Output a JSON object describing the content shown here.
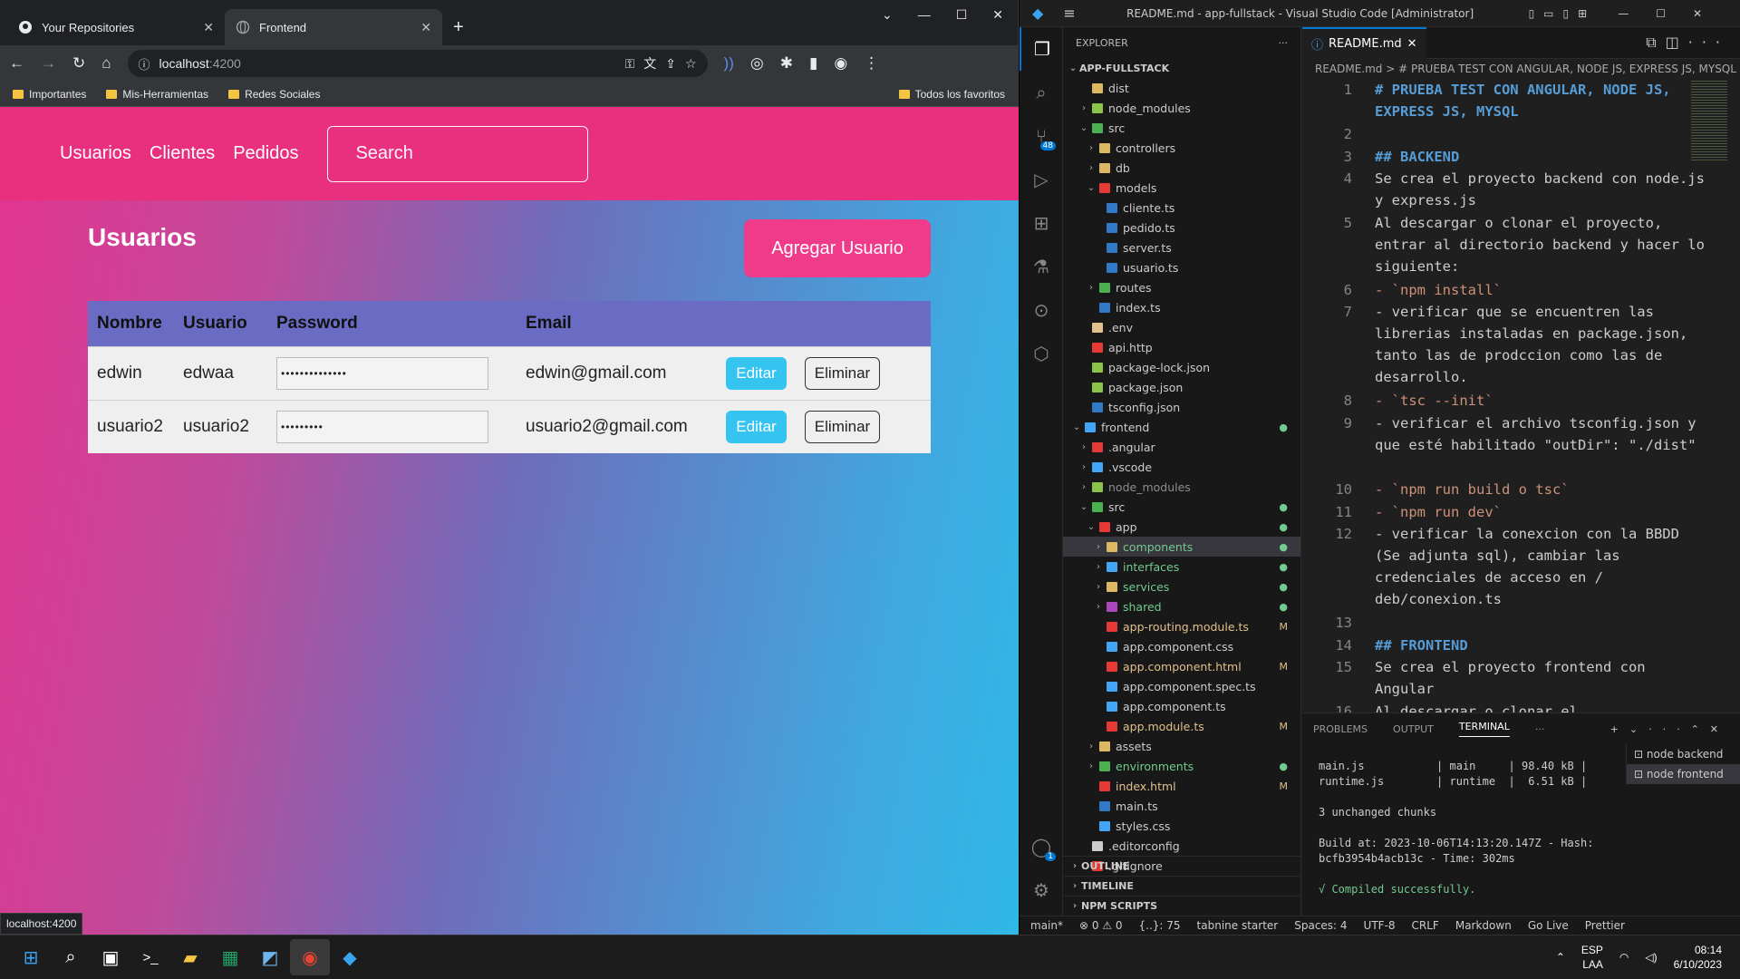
{
  "browser": {
    "tabs": [
      {
        "title": "Your Repositories",
        "icon": "github-icon"
      },
      {
        "title": "Frontend",
        "icon": "globe-icon"
      }
    ],
    "url_host": "localhost",
    "url_port": ":4200",
    "bookmarks": [
      "Importantes",
      "Mis-Herramientas",
      "Redes Sociales"
    ],
    "bookmarks_right": "Todos los favoritos",
    "status_url": "localhost:4200"
  },
  "app": {
    "nav": [
      "Usuarios",
      "Clientes",
      "Pedidos"
    ],
    "search_placeholder": "Search",
    "heading": "Usuarios",
    "add_button": "Agregar Usuario",
    "columns": [
      "Nombre",
      "Usuario",
      "Password",
      "Email"
    ],
    "rows": [
      {
        "nombre": "edwin",
        "usuario": "edwaa",
        "password": "••••••••••••••",
        "email": "edwin@gmail.com",
        "edit": "Editar",
        "delete": "Eliminar"
      },
      {
        "nombre": "usuario2",
        "usuario": "usuario2",
        "password": "•••••••••",
        "email": "usuario2@gmail.com",
        "edit": "Editar",
        "delete": "Eliminar"
      }
    ]
  },
  "vscode": {
    "title": "README.md - app-fullstack - Visual Studio Code [Administrator]",
    "explorer_label": "EXPLORER",
    "root": "APP-FULLSTACK",
    "scm_badge": "48",
    "account_badge": "1",
    "tree": [
      {
        "label": "dist",
        "depth": 2,
        "chev": "",
        "color": "#dcb862"
      },
      {
        "label": "node_modules",
        "depth": 2,
        "chev": "›",
        "color": "#8bc34a"
      },
      {
        "label": "src",
        "depth": 2,
        "chev": "⌄",
        "color": "#4caf50"
      },
      {
        "label": "controllers",
        "depth": 3,
        "chev": "›",
        "color": "#dcb862"
      },
      {
        "label": "db",
        "depth": 3,
        "chev": "›",
        "color": "#dcb862"
      },
      {
        "label": "models",
        "depth": 3,
        "chev": "⌄",
        "color": "#e53935"
      },
      {
        "label": "cliente.ts",
        "depth": 4,
        "chev": "",
        "color": "#3178c6"
      },
      {
        "label": "pedido.ts",
        "depth": 4,
        "chev": "",
        "color": "#3178c6"
      },
      {
        "label": "server.ts",
        "depth": 4,
        "chev": "",
        "color": "#3178c6"
      },
      {
        "label": "usuario.ts",
        "depth": 4,
        "chev": "",
        "color": "#3178c6"
      },
      {
        "label": "routes",
        "depth": 3,
        "chev": "›",
        "color": "#4caf50"
      },
      {
        "label": "index.ts",
        "depth": 3,
        "chev": "",
        "color": "#3178c6"
      },
      {
        "label": ".env",
        "depth": 2,
        "chev": "",
        "color": "#e2c08d"
      },
      {
        "label": "api.http",
        "depth": 2,
        "chev": "",
        "color": "#e53935"
      },
      {
        "label": "package-lock.json",
        "depth": 2,
        "chev": "",
        "color": "#8bc34a"
      },
      {
        "label": "package.json",
        "depth": 2,
        "chev": "",
        "color": "#8bc34a"
      },
      {
        "label": "tsconfig.json",
        "depth": 2,
        "chev": "",
        "color": "#3178c6"
      },
      {
        "label": "frontend",
        "depth": 1,
        "chev": "⌄",
        "color": "#42a5f5",
        "mod": "●",
        "tcolor": "#ccc"
      },
      {
        "label": ".angular",
        "depth": 2,
        "chev": "›",
        "color": "#e53935"
      },
      {
        "label": ".vscode",
        "depth": 2,
        "chev": "›",
        "color": "#42a5f5"
      },
      {
        "label": "node_modules",
        "depth": 2,
        "chev": "›",
        "color": "#8bc34a",
        "tcolor": "#8c8c8c"
      },
      {
        "label": "src",
        "depth": 2,
        "chev": "⌄",
        "color": "#4caf50",
        "mod": "●"
      },
      {
        "label": "app",
        "depth": 3,
        "chev": "⌄",
        "color": "#e53935",
        "mod": "●"
      },
      {
        "label": "components",
        "depth": 4,
        "chev": "›",
        "color": "#dcb862",
        "mod": "●",
        "tcolor": "#73c991",
        "sel": true
      },
      {
        "label": "interfaces",
        "depth": 4,
        "chev": "›",
        "color": "#42a5f5",
        "mod": "●",
        "tcolor": "#73c991"
      },
      {
        "label": "services",
        "depth": 4,
        "chev": "›",
        "color": "#dcb862",
        "mod": "●",
        "tcolor": "#73c991"
      },
      {
        "label": "shared",
        "depth": 4,
        "chev": "›",
        "color": "#ab47bc",
        "mod": "●",
        "tcolor": "#73c991"
      },
      {
        "label": "app-routing.module.ts",
        "depth": 4,
        "chev": "",
        "color": "#e53935",
        "mod": "M",
        "tcolor": "#e2c08d"
      },
      {
        "label": "app.component.css",
        "depth": 4,
        "chev": "",
        "color": "#42a5f5"
      },
      {
        "label": "app.component.html",
        "depth": 4,
        "chev": "",
        "color": "#e53935",
        "mod": "M",
        "tcolor": "#e2c08d"
      },
      {
        "label": "app.component.spec.ts",
        "depth": 4,
        "chev": "",
        "color": "#42a5f5"
      },
      {
        "label": "app.component.ts",
        "depth": 4,
        "chev": "",
        "color": "#42a5f5"
      },
      {
        "label": "app.module.ts",
        "depth": 4,
        "chev": "",
        "color": "#e53935",
        "mod": "M",
        "tcolor": "#e2c08d"
      },
      {
        "label": "assets",
        "depth": 3,
        "chev": "›",
        "color": "#dcb862"
      },
      {
        "label": "environments",
        "depth": 3,
        "chev": "›",
        "color": "#4caf50",
        "mod": "●",
        "tcolor": "#73c991"
      },
      {
        "label": "index.html",
        "depth": 3,
        "chev": "",
        "color": "#e53935",
        "mod": "M",
        "tcolor": "#e2c08d"
      },
      {
        "label": "main.ts",
        "depth": 3,
        "chev": "",
        "color": "#3178c6"
      },
      {
        "label": "styles.css",
        "depth": 3,
        "chev": "",
        "color": "#42a5f5"
      },
      {
        "label": ".editorconfig",
        "depth": 2,
        "chev": "",
        "color": "#ccc"
      },
      {
        "label": ".gitignore",
        "depth": 2,
        "chev": "",
        "color": "#e53935"
      }
    ],
    "sections": [
      "OUTLINE",
      "TIMELINE",
      "NPM SCRIPTS"
    ],
    "editor_tab": "README.md",
    "breadcrumb": "README.md  >  # PRUEBA TEST CON ANGULAR, NODE JS, EXPRESS JS, MYSQL",
    "code": [
      {
        "n": "1",
        "t": "# PRUEBA TEST CON ANGULAR, NODE JS, EXPRESS JS, MYSQL",
        "cls": "hd",
        "h": 2
      },
      {
        "n": "2",
        "t": "",
        "cls": "",
        "h": 1
      },
      {
        "n": "3",
        "t": "## BACKEND",
        "cls": "hd",
        "h": 1
      },
      {
        "n": "4",
        "t": "Se crea el proyecto backend con node.js y express.js",
        "cls": "",
        "h": 2
      },
      {
        "n": "5",
        "t": "Al descargar o clonar el proyecto, entrar al directorio backend y hacer lo siguiente:",
        "cls": "",
        "h": 3
      },
      {
        "n": "6",
        "t": "- `npm install`",
        "cls": "ic",
        "h": 1
      },
      {
        "n": "7",
        "t": "- verificar que se encuentren las librerias instaladas en package.json, tanto las de prodccion como las de desarrollo.",
        "cls": "",
        "h": 4
      },
      {
        "n": "8",
        "t": "- `tsc --init`",
        "cls": "ic",
        "h": 1
      },
      {
        "n": "9",
        "t": "- verificar el archivo tsconfig.json y que esté habilitado \"outDir\": \"./dist\"",
        "cls": "",
        "h": 3
      },
      {
        "n": "10",
        "t": "- `npm run build o tsc`",
        "cls": "ic",
        "h": 1
      },
      {
        "n": "11",
        "t": "- `npm run dev`",
        "cls": "ic",
        "h": 1
      },
      {
        "n": "12",
        "t": "- verificar la conexcion con la BBDD (Se adjunta sql), cambiar las credenciales de acceso en / deb/conexion.ts",
        "cls": "",
        "h": 4
      },
      {
        "n": "13",
        "t": "",
        "cls": "",
        "h": 1
      },
      {
        "n": "14",
        "t": "## FRONTEND",
        "cls": "hd",
        "h": 1
      },
      {
        "n": "15",
        "t": "Se crea el proyecto frontend con Angular",
        "cls": "",
        "h": 2
      },
      {
        "n": "16",
        "t": "Al descargar o clonar el",
        "cls": "",
        "h": 1
      }
    ],
    "panel_tabs": [
      "PROBLEMS",
      "OUTPUT",
      "TERMINAL"
    ],
    "terminal": [
      "main.js           | main     | 98.40 kB |",
      "runtime.js        | runtime  |  6.51 kB |",
      "",
      "3 unchanged chunks",
      "",
      "Build at: 2023-10-06T14:13:20.147Z - Hash:",
      "bcfb3954b4acb13c - Time: 302ms",
      "",
      "√ Compiled successfully."
    ],
    "terminal_list": [
      "node backend",
      "node frontend"
    ],
    "status": [
      "main*",
      "⊗ 0 ⚠ 0",
      "{..}: 75",
      "tabnine starter",
      "Spaces: 4",
      "UTF-8",
      "CRLF",
      "Markdown",
      "Go Live",
      "Prettier"
    ]
  },
  "taskbar": {
    "lang": "ESP",
    "lang2": "LAA",
    "time": "08:14",
    "date": "6/10/2023"
  }
}
